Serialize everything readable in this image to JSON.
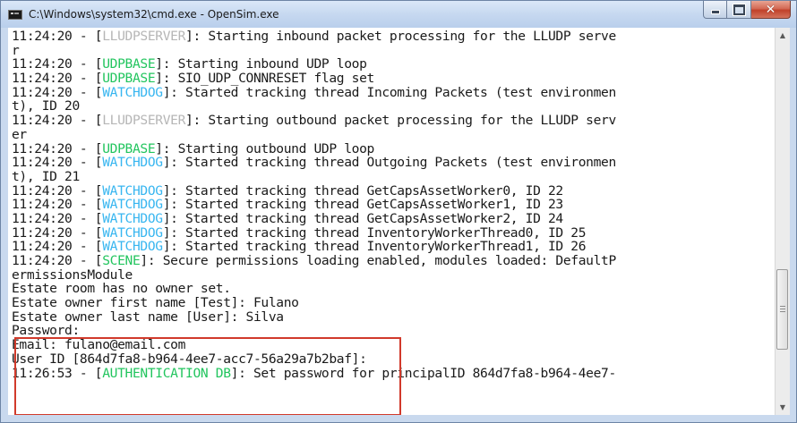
{
  "window": {
    "title": "C:\\Windows\\system32\\cmd.exe - OpenSim.exe",
    "app_icon": "console-icon",
    "buttons": {
      "minimize_icon": "minimize-icon",
      "maximize_icon": "maximize-icon",
      "close_icon": "close-icon",
      "close_glyph": "✕"
    }
  },
  "colors": {
    "tag_gray": "#b6b6b6",
    "tag_green": "#22c55e",
    "tag_cyan": "#38b6f0",
    "highlight_border": "#d13a2b"
  },
  "console": {
    "lines": [
      {
        "pre": "11:24:20 - [",
        "tag": "LLUDPSERVER",
        "color": "gray",
        "post": "]: Starting inbound packet processing for the LLUDP serve"
      },
      {
        "pre": "r",
        "tag": "",
        "color": "",
        "post": ""
      },
      {
        "pre": "11:24:20 - [",
        "tag": "UDPBASE",
        "color": "green",
        "post": "]: Starting inbound UDP loop"
      },
      {
        "pre": "11:24:20 - [",
        "tag": "UDPBASE",
        "color": "green",
        "post": "]: SIO_UDP_CONNRESET flag set"
      },
      {
        "pre": "11:24:20 - [",
        "tag": "WATCHDOG",
        "color": "cyan",
        "post": "]: Started tracking thread Incoming Packets (test environmen"
      },
      {
        "pre": "t), ID 20",
        "tag": "",
        "color": "",
        "post": ""
      },
      {
        "pre": "11:24:20 - [",
        "tag": "LLUDPSERVER",
        "color": "gray",
        "post": "]: Starting outbound packet processing for the LLUDP serv"
      },
      {
        "pre": "er",
        "tag": "",
        "color": "",
        "post": ""
      },
      {
        "pre": "11:24:20 - [",
        "tag": "UDPBASE",
        "color": "green",
        "post": "]: Starting outbound UDP loop"
      },
      {
        "pre": "11:24:20 - [",
        "tag": "WATCHDOG",
        "color": "cyan",
        "post": "]: Started tracking thread Outgoing Packets (test environmen"
      },
      {
        "pre": "t), ID 21",
        "tag": "",
        "color": "",
        "post": ""
      },
      {
        "pre": "11:24:20 - [",
        "tag": "WATCHDOG",
        "color": "cyan",
        "post": "]: Started tracking thread GetCapsAssetWorker0, ID 22"
      },
      {
        "pre": "11:24:20 - [",
        "tag": "WATCHDOG",
        "color": "cyan",
        "post": "]: Started tracking thread GetCapsAssetWorker1, ID 23"
      },
      {
        "pre": "11:24:20 - [",
        "tag": "WATCHDOG",
        "color": "cyan",
        "post": "]: Started tracking thread GetCapsAssetWorker2, ID 24"
      },
      {
        "pre": "11:24:20 - [",
        "tag": "WATCHDOG",
        "color": "cyan",
        "post": "]: Started tracking thread InventoryWorkerThread0, ID 25"
      },
      {
        "pre": "11:24:20 - [",
        "tag": "WATCHDOG",
        "color": "cyan",
        "post": "]: Started tracking thread InventoryWorkerThread1, ID 26"
      },
      {
        "pre": "11:24:20 - [",
        "tag": "SCENE",
        "color": "green",
        "post": "]: Secure permissions loading enabled, modules loaded: DefaultP"
      },
      {
        "pre": "ermissionsModule",
        "tag": "",
        "color": "",
        "post": ""
      },
      {
        "pre": "Estate room has no owner set.",
        "tag": "",
        "color": "",
        "post": ""
      },
      {
        "pre": "Estate owner first name [Test]: Fulano",
        "tag": "",
        "color": "",
        "post": ""
      },
      {
        "pre": "Estate owner last name [User]: Silva",
        "tag": "",
        "color": "",
        "post": ""
      },
      {
        "pre": "Password:",
        "tag": "",
        "color": "",
        "post": ""
      },
      {
        "pre": "Email: fulano@email.com",
        "tag": "",
        "color": "",
        "post": ""
      },
      {
        "pre": "User ID [864d7fa8-b964-4ee7-acc7-56a29a7b2baf]:",
        "tag": "",
        "color": "",
        "post": ""
      },
      {
        "pre": "11:26:53 - [",
        "tag": "AUTHENTICATION DB",
        "color": "green",
        "post": "]: Set password for principalID 864d7fa8-b964-4ee7-"
      }
    ]
  },
  "scrollbar": {
    "up_glyph": "▲",
    "down_glyph": "▼",
    "up_icon": "scroll-up-arrow-icon",
    "down_icon": "scroll-down-arrow-icon",
    "position_fraction": 0.82
  }
}
